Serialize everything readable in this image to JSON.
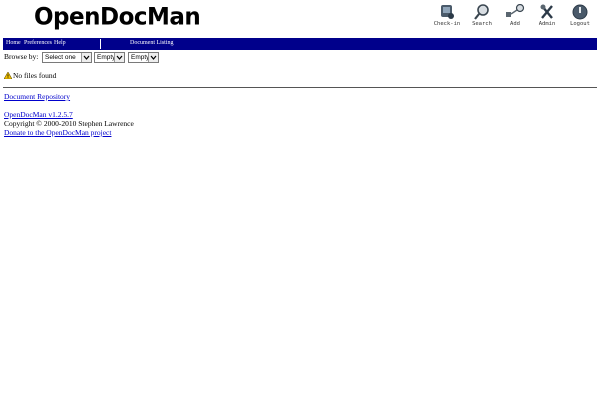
{
  "header": {
    "logo": "OpenDocMan"
  },
  "toolbar": [
    {
      "label": "Check-in",
      "icon": "check-in-icon"
    },
    {
      "label": "Search",
      "icon": "search-icon"
    },
    {
      "label": "Add",
      "icon": "add-icon"
    },
    {
      "label": "Admin",
      "icon": "admin-icon"
    },
    {
      "label": "Logout",
      "icon": "logout-icon"
    }
  ],
  "nav": {
    "home": "Home",
    "preferences": "Preferences",
    "help": "Help",
    "current": "Document Listing",
    "bar_color": "#00008b"
  },
  "browse": {
    "label": "Browse by:",
    "select1": "Select one",
    "select2": "Empty",
    "select3": "Empty"
  },
  "message": {
    "text": "No files found",
    "icon": "warning-icon"
  },
  "footer": {
    "repository": "Document Repository",
    "version": "OpenDocMan v1.2.5.7",
    "copyright": "Copyright © 2000-2010 Stephen Lawrence",
    "donate": "Donate to the OpenDocMan project",
    "link_color": "#0000cc"
  }
}
